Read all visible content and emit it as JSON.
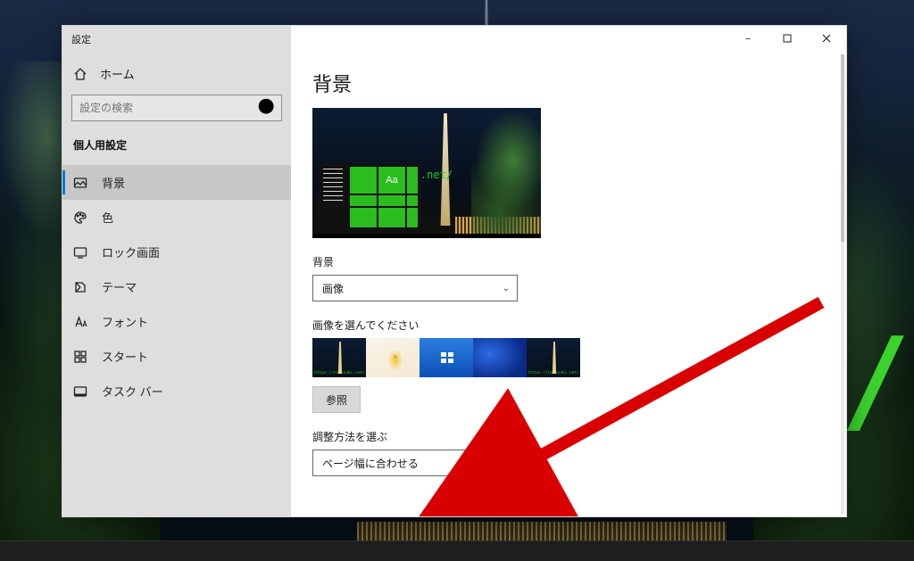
{
  "window": {
    "title": "設定"
  },
  "win_controls": {
    "min": "—",
    "max": "▢",
    "close": "✕"
  },
  "sidebar": {
    "home": "ホーム",
    "search_placeholder": "設定の検索",
    "section": "個人用設定",
    "items": [
      {
        "label": "背景"
      },
      {
        "label": "色"
      },
      {
        "label": "ロック画面"
      },
      {
        "label": "テーマ"
      },
      {
        "label": "フォント"
      },
      {
        "label": "スタート"
      },
      {
        "label": "タスク バー"
      }
    ]
  },
  "content": {
    "heading": "背景",
    "preview": {
      "aa": "Aa",
      "url": "suki.net/"
    },
    "bg_select": {
      "label": "背景",
      "value": "画像"
    },
    "choose_image": {
      "label": "画像を選んでください"
    },
    "thumb_url_overlay": "https://takosuki.net/",
    "browse": "参照",
    "fit_select": {
      "label": "調整方法を選ぶ",
      "value": "ページ幅に合わせる"
    }
  },
  "desktop": {
    "url_fragment": "t/"
  },
  "colors": {
    "accent": "#0078d4",
    "arrow": "#d90000",
    "tile_green": "#2bbd1e"
  }
}
